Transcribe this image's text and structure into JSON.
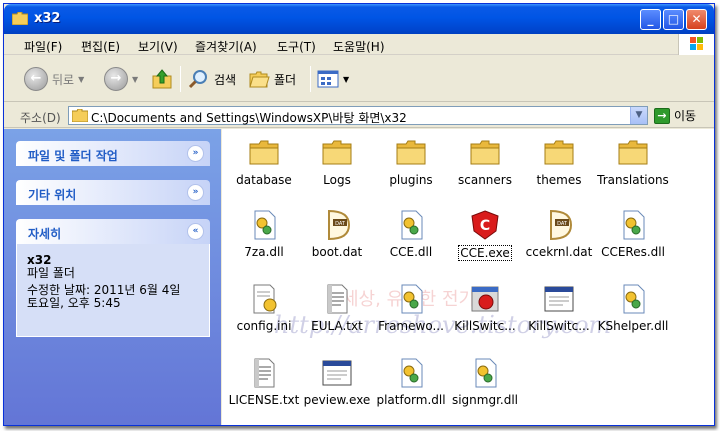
{
  "window": {
    "title": "x32",
    "controls": {
      "minimize": "_",
      "maximize": "□",
      "close": "✕"
    }
  },
  "menu": [
    {
      "label": "파일(F)"
    },
    {
      "label": "편집(E)"
    },
    {
      "label": "보기(V)"
    },
    {
      "label": "즐겨찾기(A)"
    },
    {
      "label": "도구(T)"
    },
    {
      "label": "도움말(H)"
    }
  ],
  "toolbar": {
    "back_label": "뒤로",
    "search_label": "검색",
    "folders_label": "폴더"
  },
  "address": {
    "label": "주소(D)",
    "path": "C:\\Documents and Settings\\WindowsXP\\바탕 화면\\x32",
    "go_label": "이동"
  },
  "sidebar": {
    "panes": [
      {
        "title": "파일 및 폴더 작업",
        "toggle": "»"
      },
      {
        "title": "기타 위치",
        "toggle": "»"
      },
      {
        "title": "자세히",
        "toggle": "«"
      }
    ],
    "details": {
      "name": "x32",
      "type": "파일 폴더",
      "modified_line1": "수정한 날짜: 2011년 6월 4일",
      "modified_line2": "토요일, 오후 5:45"
    }
  },
  "files": [
    {
      "name": "database",
      "icon": "folder-icon"
    },
    {
      "name": "Logs",
      "icon": "folder-icon"
    },
    {
      "name": "plugins",
      "icon": "folder-icon"
    },
    {
      "name": "scanners",
      "icon": "folder-icon"
    },
    {
      "name": "themes",
      "icon": "folder-icon"
    },
    {
      "name": "Translations",
      "icon": "folder-icon"
    },
    {
      "name": "7za.dll",
      "icon": "dll-icon"
    },
    {
      "name": "boot.dat",
      "icon": "dat-icon"
    },
    {
      "name": "CCE.dll",
      "icon": "dll-icon"
    },
    {
      "name": "CCE.exe",
      "icon": "comodo-icon",
      "selected": true
    },
    {
      "name": "ccekrnl.dat",
      "icon": "dat-icon"
    },
    {
      "name": "CCERes.dll",
      "icon": "dll-icon"
    },
    {
      "name": "config.ini",
      "icon": "ini-icon"
    },
    {
      "name": "EULA.txt",
      "icon": "txt-icon"
    },
    {
      "name": "Framewo...",
      "icon": "dll-icon"
    },
    {
      "name": "KillSwitc...",
      "icon": "killswitch-icon"
    },
    {
      "name": "KillSwitc...",
      "icon": "exe-window-icon"
    },
    {
      "name": "KShelper.dll",
      "icon": "dll-icon"
    },
    {
      "name": "LICENSE.txt",
      "icon": "txt-icon"
    },
    {
      "name": "peview.exe",
      "icon": "exe-window-icon"
    },
    {
      "name": "platform.dll",
      "icon": "dll-icon"
    },
    {
      "name": "signmgr.dll",
      "icon": "dll-icon"
    }
  ],
  "watermark": {
    "text1": "http://arreshove.tistory.com",
    "text2": "세상, 유쾌한 전기"
  },
  "colors": {
    "titlebar": "#0055e5",
    "sidebar": "#6375d6",
    "folder": "#f5cd5a"
  }
}
